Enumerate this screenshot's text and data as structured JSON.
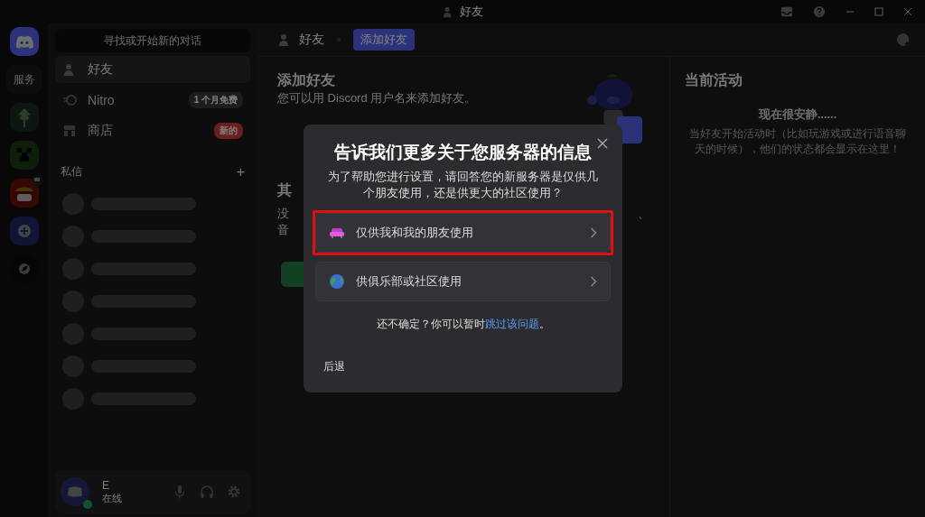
{
  "window": {
    "title": "好友"
  },
  "server_rail": {
    "folder_label": "服务",
    "servers": [
      {
        "kind": "home",
        "selected": true
      },
      {
        "kind": "label"
      },
      {
        "kind": "tree"
      },
      {
        "kind": "creeper"
      },
      {
        "kind": "pirate",
        "badge": true
      },
      {
        "kind": "add"
      },
      {
        "kind": "explore"
      }
    ]
  },
  "sidebar": {
    "search": {
      "placeholder": "寻找或开始新的对话"
    },
    "items": [
      {
        "label": "好友",
        "selected": true
      },
      {
        "label": "Nitro",
        "selected": false,
        "badge": "1 个月免费"
      },
      {
        "label": "商店",
        "selected": false,
        "badge": "新的"
      }
    ],
    "dm_header": "私信",
    "dm_add": "+"
  },
  "user_panel": {
    "name": "E",
    "status": "在线",
    "online": true
  },
  "header": {
    "title": "好友",
    "tabs": [
      {
        "label": "添加好友",
        "selected": true
      }
    ]
  },
  "add_friend": {
    "title": "添加好友",
    "subtitle": "您可以用 Discord 用户名来添加好友。",
    "other_heading_fragment": "其",
    "other_lines_fragment": [
      "没",
      "音"
    ],
    "other_tail_fragment": "、"
  },
  "activity": {
    "title": "当前活动",
    "empty_title": "现在很安静......",
    "empty_text": "当好友开始活动时（比如玩游戏或进行语音聊天的时候），他们的状态都会显示在这里！"
  },
  "modal": {
    "title": "告诉我们更多关于您服务器的信息",
    "subtitle": "为了帮助您进行设置，请回答您的新服务器是仅供几个朋友使用，还是供更大的社区使用？",
    "options": [
      {
        "label": "仅供我和我的朋友使用",
        "kind": "friends",
        "highlighted": true
      },
      {
        "label": "供俱乐部或社区使用",
        "kind": "community",
        "highlighted": false
      }
    ],
    "note": "还不确定？你可以暂时",
    "note_link": "跳过该问题",
    "note_end": "。",
    "back": "后退"
  }
}
